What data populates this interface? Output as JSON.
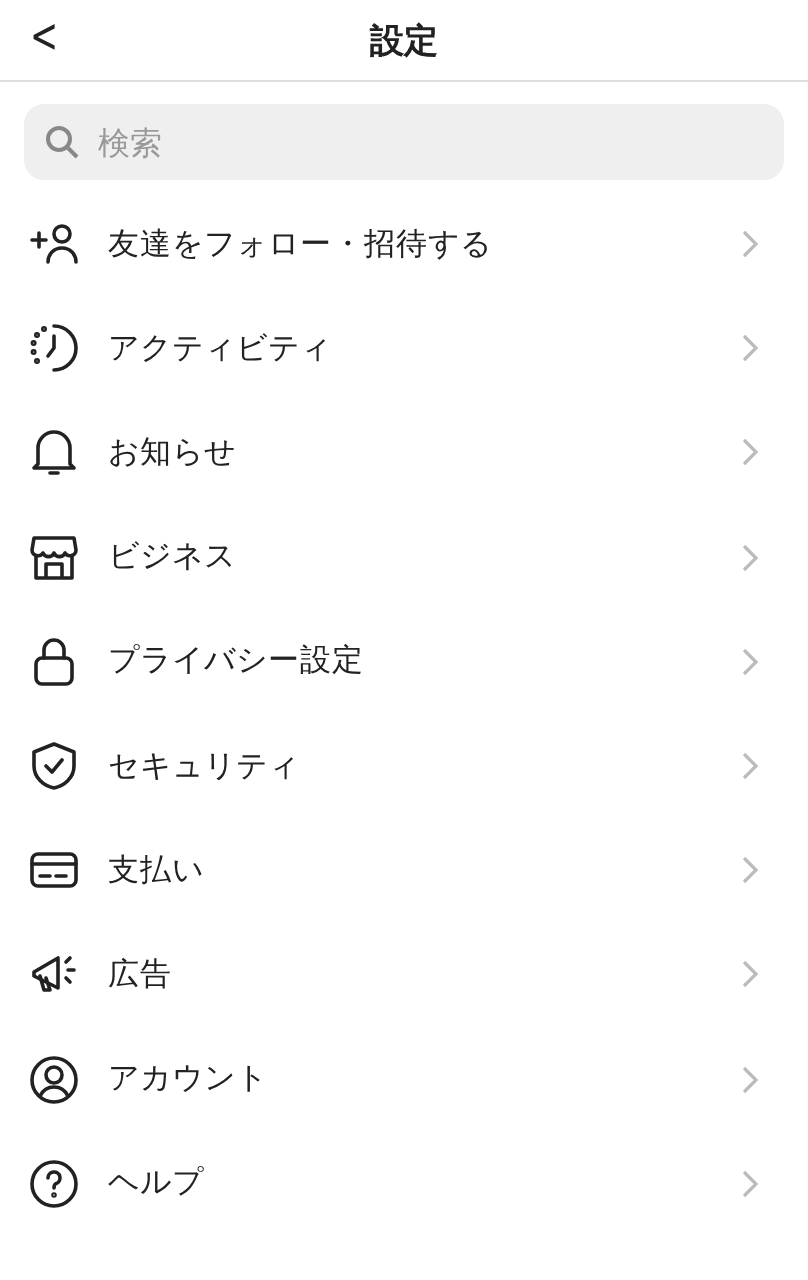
{
  "header": {
    "back": "<",
    "title": "設定"
  },
  "search": {
    "placeholder": "検索"
  },
  "items": [
    {
      "kind": "follow",
      "label": "友達をフォロー・招待する"
    },
    {
      "kind": "activity",
      "label": "アクティビティ"
    },
    {
      "kind": "notifications",
      "label": "お知らせ"
    },
    {
      "kind": "business",
      "label": "ビジネス"
    },
    {
      "kind": "privacy",
      "label": "プライバシー設定"
    },
    {
      "kind": "security",
      "label": "セキュリティ"
    },
    {
      "kind": "payments",
      "label": "支払い"
    },
    {
      "kind": "ads",
      "label": "広告"
    },
    {
      "kind": "account",
      "label": "アカウント"
    },
    {
      "kind": "help",
      "label": "ヘルプ"
    }
  ]
}
